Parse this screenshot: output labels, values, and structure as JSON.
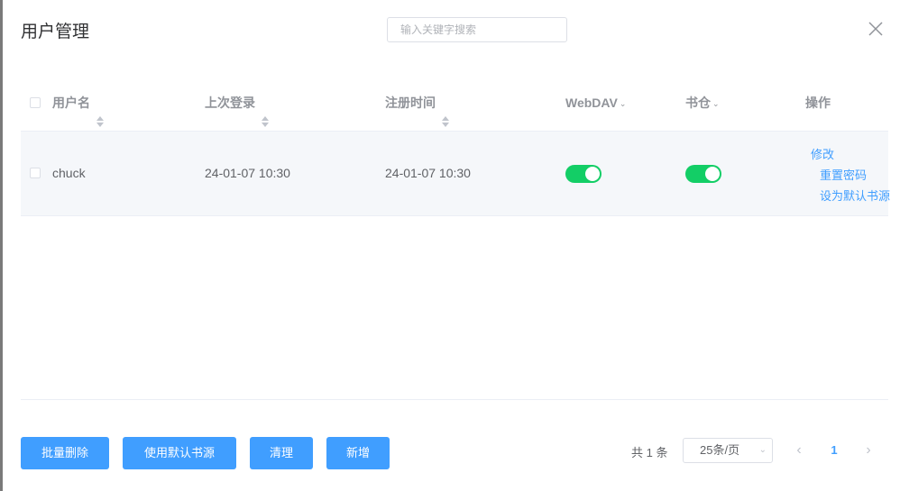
{
  "dialog": {
    "title": "用户管理",
    "search_placeholder": "输入关键字搜索"
  },
  "table": {
    "columns": [
      {
        "label": "用户名",
        "sortable": true
      },
      {
        "label": "上次登录",
        "sortable": true
      },
      {
        "label": "注册时间",
        "sortable": true
      },
      {
        "label": "WebDAV",
        "filter": true
      },
      {
        "label": "书仓",
        "filter": true
      },
      {
        "label": "操作"
      }
    ],
    "rows": [
      {
        "username": "chuck",
        "last_login": "24-01-07 10:30",
        "registered": "24-01-07 10:30",
        "webdav_enabled": true,
        "bookstore_enabled": true,
        "actions": [
          "修改",
          "重置密码",
          "设为默认书源"
        ]
      }
    ]
  },
  "footer": {
    "buttons": [
      "批量删除",
      "使用默认书源",
      "清理",
      "新增"
    ],
    "total": "共 1 条",
    "page_size": "25条/页",
    "current_page": "1"
  },
  "colors": {
    "primary": "#409eff",
    "switch_on": "#13ce66",
    "row_bg": "#f5f7fa"
  }
}
